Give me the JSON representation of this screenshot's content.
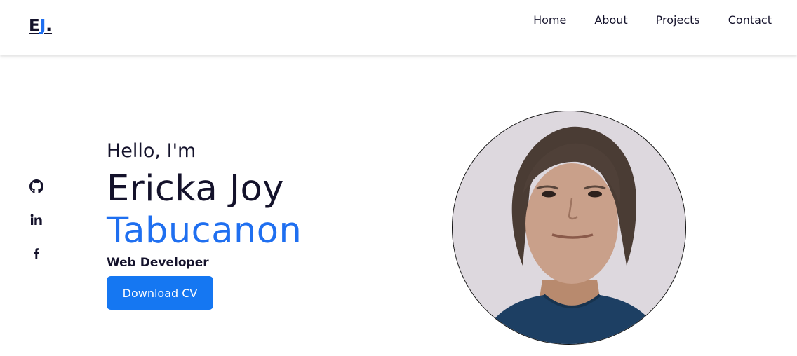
{
  "header": {
    "logo": {
      "first": "E",
      "accent": "J",
      "dot": "."
    },
    "nav": [
      "Home",
      "About",
      "Projects",
      "Contact"
    ]
  },
  "social": {
    "icons": [
      "github-icon",
      "linkedin-icon",
      "facebook-icon"
    ]
  },
  "hero": {
    "greeting": "Hello, I'm",
    "name_first": "Ericka Joy",
    "name_last": "Tabucanon",
    "role": "Web Developer",
    "cta_label": "Download CV"
  },
  "colors": {
    "accent": "#1f6ff0",
    "button": "#1577f2",
    "text": "#14122b"
  }
}
